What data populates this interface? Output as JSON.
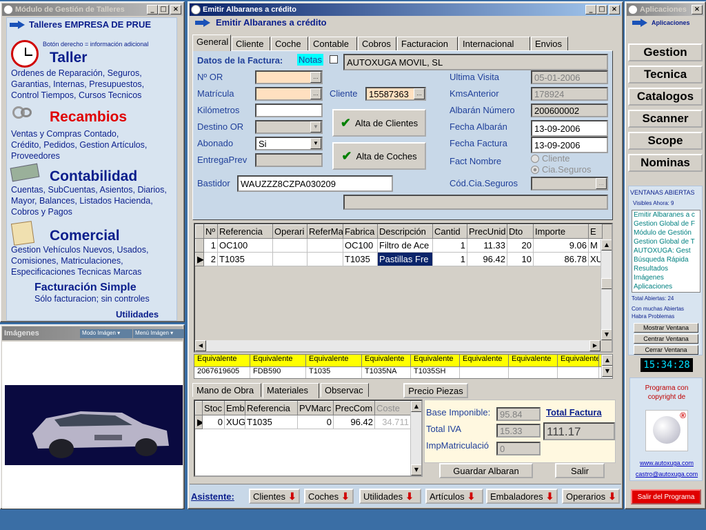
{
  "left_window": {
    "title": "Módulo de Gestión de Talleres",
    "header": "Talleres EMPRESA DE PRUE",
    "hint": "Botón derecho = información adicional",
    "sections": [
      {
        "title": "Taller",
        "desc": "Ordenes de Reparación, Seguros, Garantias, Internas, Presupuestos, Control Tiempos, Cursos Tecnicos"
      },
      {
        "title": "Recambios",
        "desc": "Ventas y Compras Contado, Crédito, Pedidos, Gestion Artículos, Proveedores"
      },
      {
        "title": "Contabilidad",
        "desc": "Cuentas, SubCuentas, Asientos, Diarios, Mayor, Balances, Listados Hacienda, Cobros y Pagos"
      },
      {
        "title": "Comercial",
        "desc": "Gestion Vehículos Nuevos, Usados, Comisiones, Matriculaciones, Especificaciones Tecnicas Marcas"
      }
    ],
    "fact_simple": "Facturación Simple",
    "fact_simple_desc": "Sólo facturacion; sin controles",
    "utilidades": "Utilidades"
  },
  "images_panel": {
    "title": "Imágenes",
    "modo": "Modo Imágen",
    "menu": "Menú Imágen"
  },
  "main_window": {
    "title": "Emitir Albaranes a crédito",
    "header": "Emitir Albaranes a crédito",
    "tabs": [
      "General",
      "Cliente",
      "Coche",
      "Contable",
      "Cobros",
      "Facturacion",
      "Internacional",
      "Envios"
    ],
    "datos_label": "Datos de la Factura:",
    "notas": "Notas",
    "customer_name": "AUTOXUGA MOVIL, SL",
    "labels": {
      "nor": "Nº OR",
      "matricula": "Matrícula",
      "kilometros": "Kilómetros",
      "destino": "Destino OR",
      "abonado": "Abonado",
      "entregaprev": "EntregaPrev",
      "bastidor": "Bastidor",
      "cliente": "Cliente",
      "ultima_visita": "Ultima Visita",
      "kms_anterior": "KmsAnterior",
      "albaran_numero": "Albarán Número",
      "fecha_albaran": "Fecha Albarán",
      "fecha_factura": "Fecha Factura",
      "fact_nombre": "Fact Nombre",
      "cod_cia": "Cód.Cia.Seguros"
    },
    "values": {
      "abonado": "Si",
      "bastidor": "WAUZZZ8CZPA030209",
      "cliente": "15587363",
      "ultima_visita": "05-01-2006",
      "kms_anterior": "178924",
      "albaran_numero": "200600002",
      "fecha_albaran": "13-09-2006",
      "fecha_factura": "13-09-2006"
    },
    "radio_cliente": "Cliente",
    "radio_cia": "Cia.Seguros",
    "btn_alta_clientes": "Alta de Clientes",
    "btn_alta_coches": "Alta de Coches",
    "grid_headers": [
      "Nº",
      "Referencia",
      "Operari",
      "ReferMa",
      "Fabrica",
      "Descripción",
      "Cantid",
      "PrecUnid",
      "Dto",
      "Importe",
      "E"
    ],
    "grid_rows": [
      {
        "n": "1",
        "ref": "OC100",
        "op": "",
        "refm": "",
        "fab": "OC100",
        "desc": "Filtro de Ace",
        "cant": "1",
        "prec": "11.33",
        "dto": "20",
        "imp": "9.06",
        "e": "M"
      },
      {
        "n": "2",
        "ref": "T1035",
        "op": "",
        "refm": "",
        "fab": "T1035",
        "desc": "Pastillas Fre",
        "cant": "1",
        "prec": "96.42",
        "dto": "10",
        "imp": "86.78",
        "e": "XU"
      }
    ],
    "equiv_header": "Equivalente",
    "equiv_values": [
      "2067619605",
      "FDB590",
      "T1035",
      "T1035NA",
      "T1035SH",
      "",
      "",
      ""
    ],
    "bottom_tabs": [
      "Mano de Obra",
      "Materiales",
      "Observac"
    ],
    "precio_piezas": "Precio Piezas",
    "stock_headers": [
      "Stoc",
      "Emb",
      "Referencia",
      "PVMarc",
      "PrecCom",
      "Coste"
    ],
    "stock_row": {
      "stoc": "0",
      "emb": "XUG",
      "ref": "T1035",
      "pvm": "0",
      "prec": "96.42",
      "coste": "34.711"
    },
    "base_imponible_lbl": "Base Imponible:",
    "base_imponible": "95.84",
    "total_iva_lbl": "Total IVA",
    "total_iva": "15.33",
    "imp_matric_lbl": "ImpMatriculació",
    "imp_matric": "0",
    "total_factura_lbl": "Total Factura",
    "total_factura": "111.17",
    "btn_guardar": "Guardar Albaran",
    "btn_salir": "Salir",
    "asistente": "Asistente:",
    "asist_buttons": [
      "Clientes",
      "Coches",
      "Utilidades",
      "Artículos",
      "Embaladores",
      "Operarios"
    ]
  },
  "right_window": {
    "title": "Aplicaciones",
    "header": "Aplicaciones",
    "buttons": [
      "Gestion",
      "Tecnica",
      "Catalogos",
      "Scanner",
      "Scope",
      "Nominas"
    ],
    "ventanas_title": "VENTANAS ABIERTAS",
    "visibles": "Visibles Ahora: 9",
    "open_list": [
      "Emitir Albaranes a c",
      "Gestion Global de F",
      "Módulo de Gestión",
      "Gestion Global de T",
      "AUTOXUGA: Gest",
      "Búsqueda Rápida",
      "Resultados",
      "Imágenes",
      "Aplicaciones"
    ],
    "total_abiertas": "Total Abiertas: 24",
    "warning": "Con muchas Abiertas Habra Problemas",
    "btn_mostrar": "Mostrar Ventana",
    "btn_centrar": "Centrar Ventana",
    "btn_cerrar": "Cerrar Ventana",
    "clock": "15:34:28",
    "copyright": "Programa con copyright de",
    "web": "www.autoxuga.com",
    "email": "castro@autoxuga.com",
    "btn_salir": "Salir del Programa"
  },
  "colors": {
    "title_active": "#0a246a",
    "link_blue": "#0a1e8c",
    "recambios_red": "#e00000",
    "peach": "#ffe0c0",
    "yellow": "#ffff00"
  }
}
